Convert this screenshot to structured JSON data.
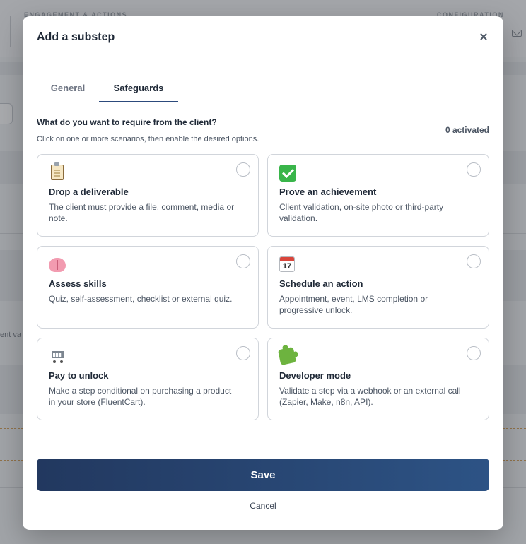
{
  "background": {
    "left_heading": "ENGAGEMENT & ACTIONS",
    "right_heading": "CONFIGURATION",
    "partial_text": "ent va"
  },
  "modal": {
    "title": "Add a substep",
    "tabs": [
      {
        "label": "General",
        "active": false
      },
      {
        "label": "Safeguards",
        "active": true
      }
    ],
    "question": "What do you want to require from the client?",
    "hint": "Click on one or more scenarios, then enable the desired options.",
    "activated_count": "0 activated",
    "scenarios": [
      {
        "icon": "clipboard-icon",
        "title": "Drop a deliverable",
        "description": "The client must provide a file, comment, media or note.",
        "selected": false
      },
      {
        "icon": "check-mark-icon",
        "title": "Prove an achievement",
        "description": "Client validation, on-site photo or third-party validation.",
        "selected": false
      },
      {
        "icon": "brain-icon",
        "title": "Assess skills",
        "description": "Quiz, self-assessment, checklist or external quiz.",
        "selected": false
      },
      {
        "icon": "calendar-icon",
        "icon_text": "17",
        "title": "Schedule an action",
        "description": "Appointment, event, LMS completion or progressive unlock.",
        "selected": false
      },
      {
        "icon": "shopping-cart-icon",
        "title": "Pay to unlock",
        "description": "Make a step conditional on purchasing a product in your store (FluentCart).",
        "selected": false
      },
      {
        "icon": "puzzle-piece-icon",
        "title": "Developer mode",
        "description": "Validate a step via a webhook or an external call (Zapier, Make, n8n, API).",
        "selected": false
      }
    ],
    "save_label": "Save",
    "cancel_label": "Cancel",
    "accent_color": "#2c4a7c"
  }
}
